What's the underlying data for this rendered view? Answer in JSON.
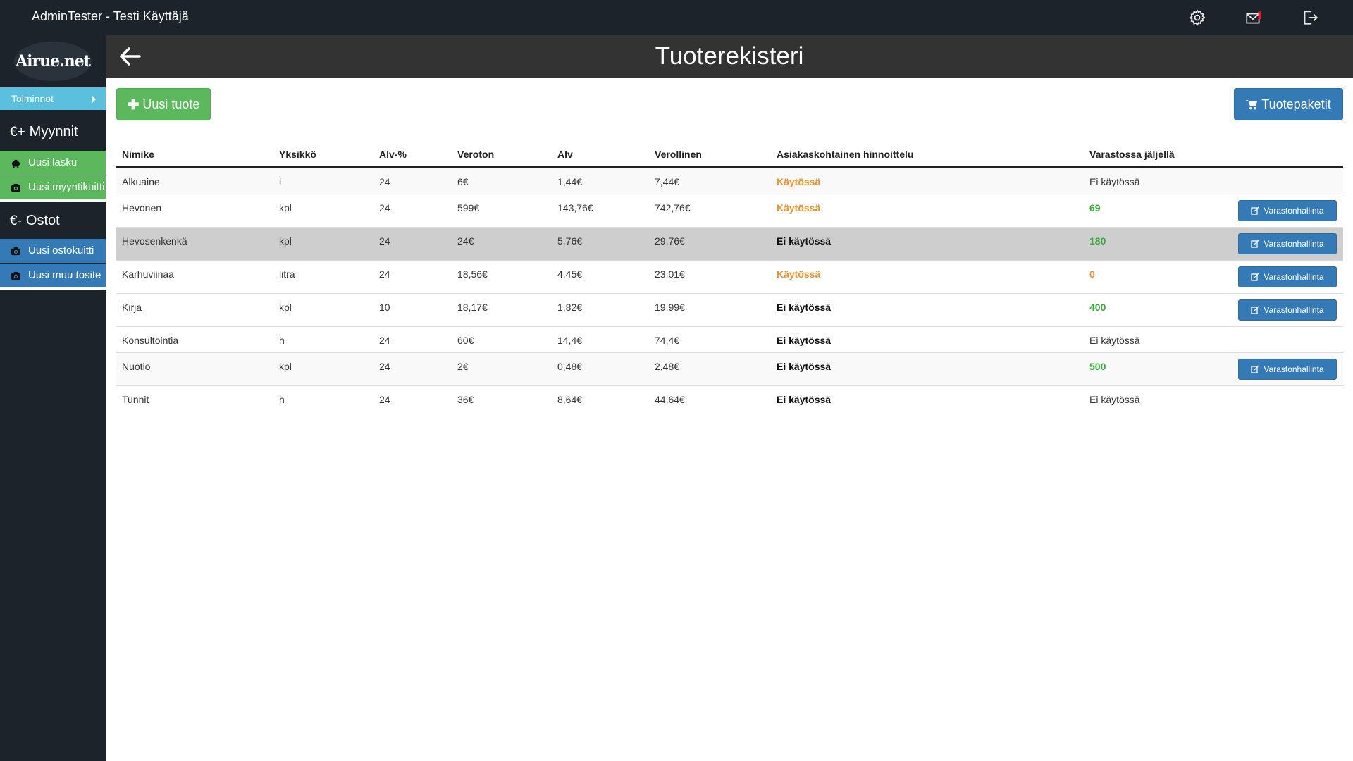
{
  "topbar": {
    "user": "AdminTester - Testi Käyttäjä",
    "icons": [
      "gear-icon",
      "mail-icon",
      "logout-icon"
    ]
  },
  "sidebar": {
    "logo": "Airue.net",
    "toiminnot": "Toiminnot",
    "sales": {
      "currency": "€+",
      "title": "Myynnit",
      "items": [
        "Uusi lasku",
        "Uusi myyntikuitti"
      ]
    },
    "purchases": {
      "currency": "€-",
      "title": "Ostot",
      "items": [
        "Uusi ostokuitti",
        "Uusi muu tosite"
      ]
    }
  },
  "header": {
    "title": "Tuoterekisteri"
  },
  "buttons": {
    "new_product": "Uusi tuote",
    "packages": "Tuotepaketit",
    "inventory": "Varastonhallinta"
  },
  "table": {
    "headers": [
      "Nimike",
      "Yksikkö",
      "Alv-%",
      "Veroton",
      "Alv",
      "Verollinen",
      "Asiakaskohtainen hinnoittelu",
      "Varastossa jäljellä"
    ],
    "rows": [
      {
        "name": "Alkuaine",
        "unit": "l",
        "vat_pct": "24",
        "net": "6€",
        "vat": "1,44€",
        "gross": "7,44€",
        "pricing": "Käytössä",
        "stock": "Ei käytössä"
      },
      {
        "name": "Hevonen",
        "unit": "kpl",
        "vat_pct": "24",
        "net": "599€",
        "vat": "143,76€",
        "gross": "742,76€",
        "pricing": "Käytössä",
        "stock": "69"
      },
      {
        "name": "Hevosenkenkä",
        "unit": "kpl",
        "vat_pct": "24",
        "net": "24€",
        "vat": "5,76€",
        "gross": "29,76€",
        "pricing": "Ei käytössä",
        "stock": "180"
      },
      {
        "name": "Karhuviinaa",
        "unit": "litra",
        "vat_pct": "24",
        "net": "18,56€",
        "vat": "4,45€",
        "gross": "23,01€",
        "pricing": "Käytössä",
        "stock": "0"
      },
      {
        "name": "Kirja",
        "unit": "kpl",
        "vat_pct": "10",
        "net": "18,17€",
        "vat": "1,82€",
        "gross": "19,99€",
        "pricing": "Ei käytössä",
        "stock": "400"
      },
      {
        "name": "Konsultointia",
        "unit": "h",
        "vat_pct": "24",
        "net": "60€",
        "vat": "14,4€",
        "gross": "74,4€",
        "pricing": "Ei käytössä",
        "stock": "Ei käytössä"
      },
      {
        "name": "Nuotio",
        "unit": "kpl",
        "vat_pct": "24",
        "net": "2€",
        "vat": "0,48€",
        "gross": "2,48€",
        "pricing": "Ei käytössä",
        "stock": "500"
      },
      {
        "name": "Tunnit",
        "unit": "h",
        "vat_pct": "24",
        "net": "36€",
        "vat": "8,64€",
        "gross": "44,64€",
        "pricing": "Ei käytössä",
        "stock": "Ei käytössä"
      }
    ]
  }
}
